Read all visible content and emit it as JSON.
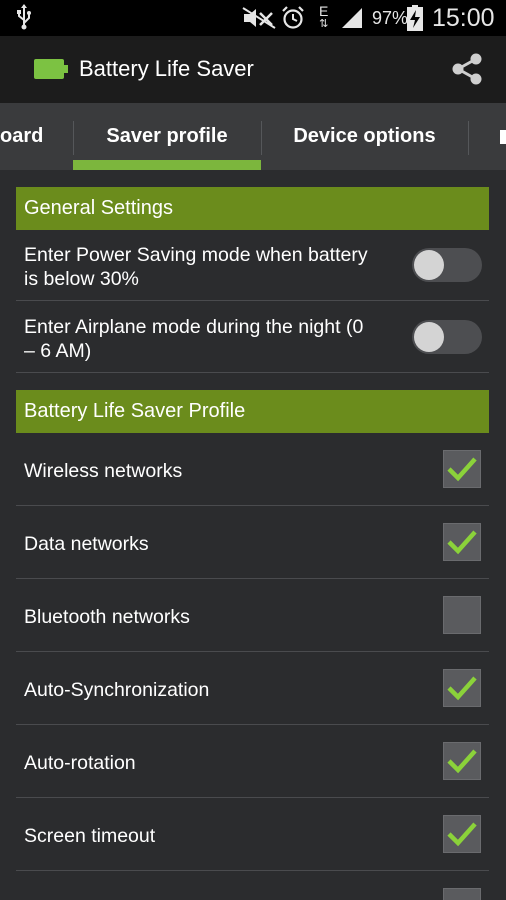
{
  "status_bar": {
    "battery_percent": "97%",
    "time": "15:00",
    "network_type": "E"
  },
  "action_bar": {
    "title": "Battery Life Saver",
    "logo_icon": "battery-icon",
    "share_icon": "share-icon"
  },
  "tabs": [
    {
      "label": "oard"
    },
    {
      "label": "Saver profile"
    },
    {
      "label": "Device options"
    }
  ],
  "selected_tab": "Saver profile",
  "general_settings": {
    "header": "General Settings",
    "items": [
      {
        "label_line1": "Enter Power Saving mode when battery",
        "label_line2": "is below 30%",
        "enabled": false
      },
      {
        "label_line1": "Enter Airplane mode during the night (0",
        "label_line2": "– 6 AM)",
        "enabled": false
      }
    ]
  },
  "profile": {
    "header": "Battery Life Saver Profile",
    "items": [
      {
        "label": "Wireless networks",
        "checked": true
      },
      {
        "label": "Data networks",
        "checked": true
      },
      {
        "label": "Bluetooth networks",
        "checked": false
      },
      {
        "label": "Auto-Synchronization",
        "checked": true
      },
      {
        "label": "Auto-rotation",
        "checked": true
      },
      {
        "label": "Screen timeout",
        "checked": true
      }
    ]
  },
  "colors": {
    "accent": "#7cb63d",
    "section_header": "#6b8c1c",
    "check": "#8bd23a"
  }
}
